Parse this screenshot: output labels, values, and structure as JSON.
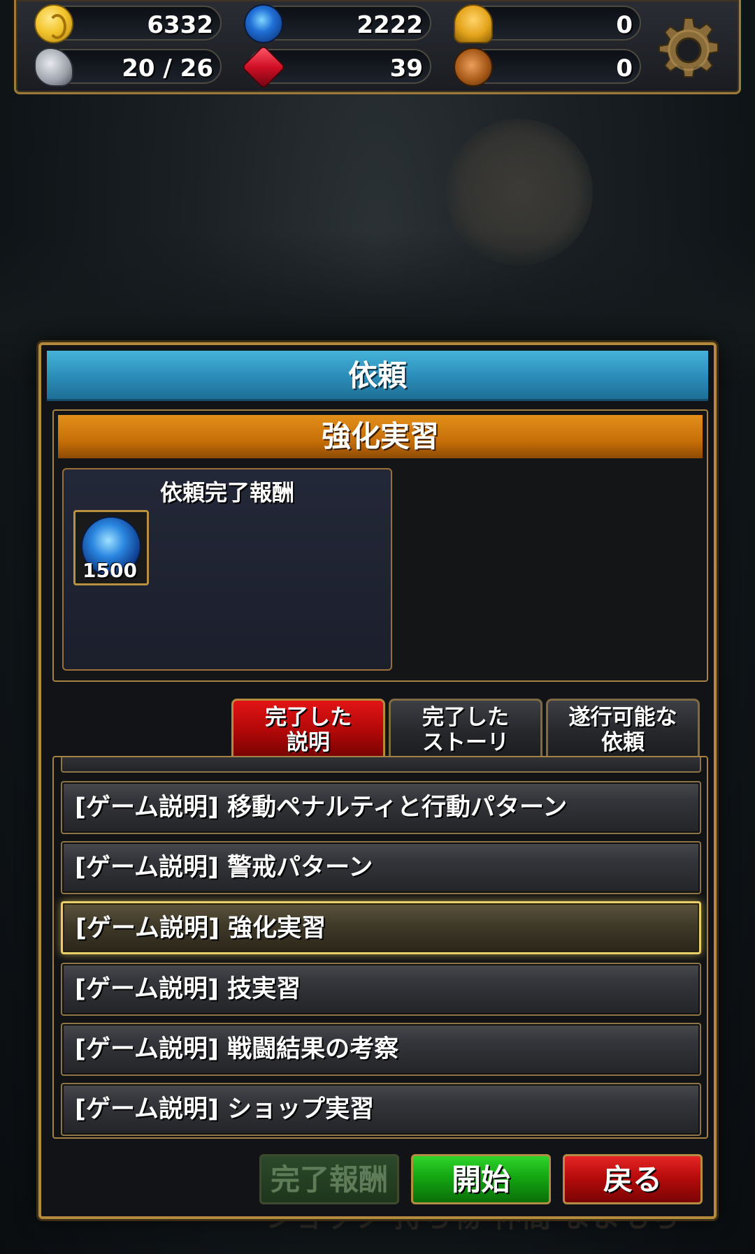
{
  "hud": {
    "gold": "6332",
    "orbs": "2222",
    "medals": "0",
    "stamina": "20 / 26",
    "rubies": "39",
    "bags": "0",
    "icons": [
      "coin-icon",
      "orb-icon",
      "medal-icon",
      "wing-icon",
      "ruby-icon",
      "bag-icon",
      "gear-icon"
    ]
  },
  "dialog": {
    "title": "依頼",
    "quest_name": "強化実習",
    "reward_title": "依頼完了報酬",
    "reward_count": "1500"
  },
  "tabs": [
    {
      "label": "完了した\n説明",
      "active": true
    },
    {
      "label": "完了した\nストーリ",
      "active": false
    },
    {
      "label": "遂行可能な\n依頼",
      "active": false
    }
  ],
  "list": [
    {
      "label": "[ゲーム説明] 移動ペナルティと行動パターン",
      "selected": false
    },
    {
      "label": "[ゲーム説明] 警戒パターン",
      "selected": false
    },
    {
      "label": "[ゲーム説明] 強化実習",
      "selected": true
    },
    {
      "label": "[ゲーム説明] 技実習",
      "selected": false
    },
    {
      "label": "[ゲーム説明] 戦闘結果の考察",
      "selected": false
    },
    {
      "label": "[ゲーム説明] ショップ実習",
      "selected": false
    }
  ],
  "buttons": {
    "reward": "完了報酬",
    "start": "開始",
    "back": "戻る"
  },
  "bottom_nav_partial": "ショップ  持ち物  仲間  まよもち",
  "colors": {
    "title_bar": "#2a8cb8",
    "quest_bar": "#c76f08",
    "active_tab": "#b20808",
    "start_button": "#14a612",
    "back_button": "#b80b0b",
    "border_gold": "#b38a3b"
  }
}
